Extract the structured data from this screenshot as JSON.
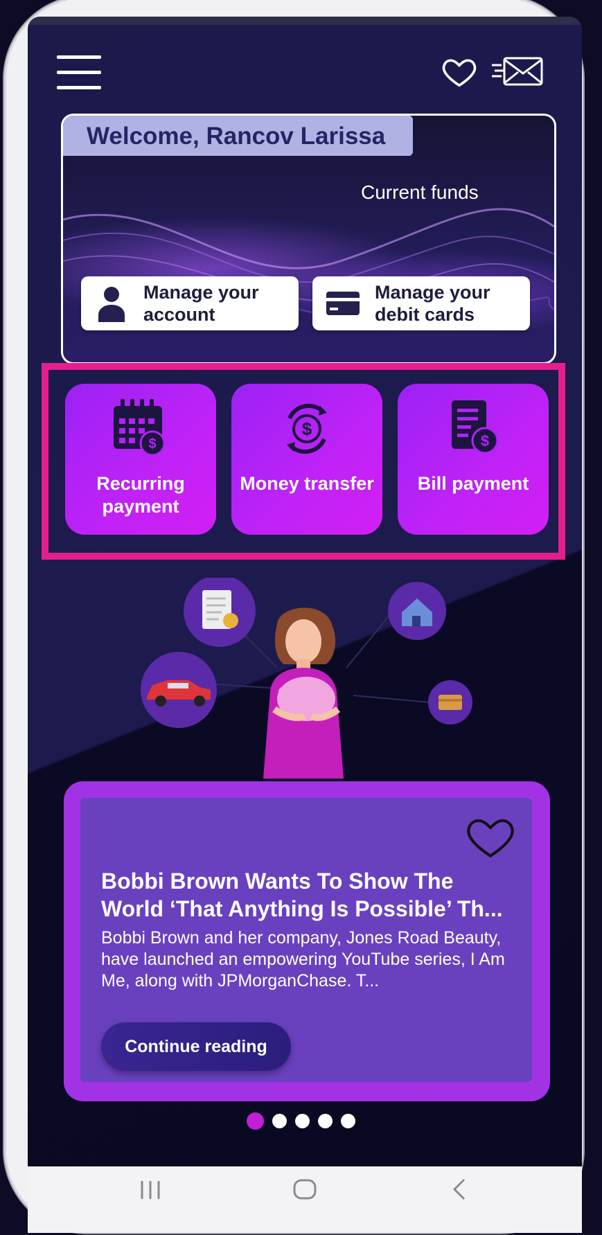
{
  "header": {
    "menu_icon": "hamburger-menu-icon",
    "favorites_icon": "heart-outline-icon",
    "messages_icon": "flying-envelope-icon"
  },
  "account_card": {
    "welcome": "Welcome, Rancov Larissa",
    "funds_label": "Current funds",
    "manage_account": "Manage your account",
    "manage_cards": "Manage your debit cards"
  },
  "quick_actions": [
    {
      "label": "Recurring payment",
      "icon": "calendar-dollar-icon"
    },
    {
      "label": "Money transfer",
      "icon": "circular-transfer-dollar-icon"
    },
    {
      "label": "Bill payment",
      "icon": "bill-dollar-icon"
    }
  ],
  "article": {
    "title": "Bobbi Brown Wants To Show The World ‘That Anything Is Possible’ Th...",
    "body": "Bobbi Brown and her company, Jones Road Beauty, have launched an empowering YouTube series, I Am Me, along with JPMorganChase. T...",
    "cta": "Continue reading"
  },
  "pager": {
    "count": 5,
    "active": 0
  },
  "colors": {
    "accent": "#c21fd6",
    "tile": "#b022f6",
    "highlight_frame": "#e41f8c",
    "card": "#6941bf",
    "background": "#1a1745"
  }
}
